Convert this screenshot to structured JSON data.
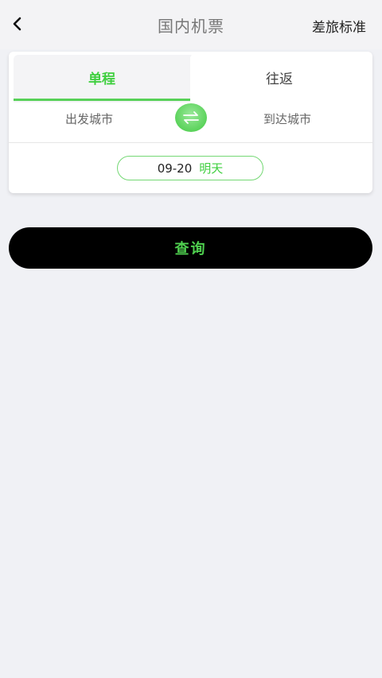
{
  "header": {
    "title": "国内机票",
    "right_action": "差旅标准"
  },
  "trip_tabs": {
    "one_way": "单程",
    "round_trip": "往返",
    "active": "one_way"
  },
  "cities": {
    "departure_placeholder": "出发城市",
    "arrival_placeholder": "到达城市"
  },
  "date": {
    "value": "09-20",
    "relative": "明天"
  },
  "search_button": "查询",
  "colors": {
    "accent": "#3fcf3f",
    "background": "#f0f1f5",
    "button": "#000000"
  },
  "icons": {
    "back": "chevron-left-icon",
    "swap": "swap-arrows-icon"
  }
}
